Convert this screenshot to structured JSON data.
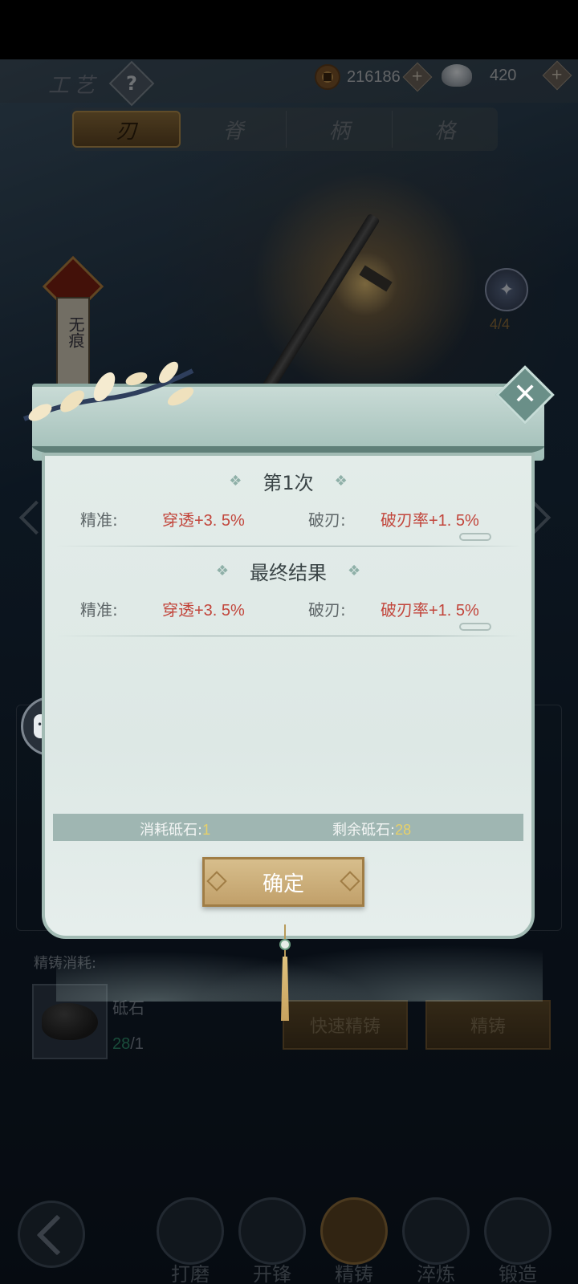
{
  "header": {
    "title": "工艺",
    "help_icon": "?",
    "coins": "216186",
    "silver": "420",
    "plus": "+"
  },
  "tabs": [
    {
      "label": "刃",
      "active": true
    },
    {
      "label": "脊",
      "active": false
    },
    {
      "label": "柄",
      "active": false
    },
    {
      "label": "格",
      "active": false
    }
  ],
  "weapon": {
    "name_vertical": "无痕",
    "skill_count": "4/4"
  },
  "modal": {
    "close_symbol": "✕",
    "round_title": "第1次",
    "final_title": "最终结果",
    "rows": [
      {
        "label1": "精准:",
        "value1": "穿透+3. 5%",
        "label2": "破刃:",
        "value2": "破刃率+1. 5%"
      },
      {
        "label1": "精准:",
        "value1": "穿透+3. 5%",
        "label2": "破刃:",
        "value2": "破刃率+1. 5%"
      }
    ],
    "consumed_label": "消耗砥石:",
    "consumed_value": "1",
    "remaining_label": "剩余砥石:",
    "remaining_value": "28",
    "confirm_label": "确定"
  },
  "refine": {
    "cost_label": "精铸消耗:",
    "stone_name": "砥石",
    "stone_have": "28",
    "stone_need": "/1",
    "quick_button": "快速精铸",
    "refine_button": "精铸"
  },
  "bottom_nav": [
    {
      "label": "打磨",
      "active": false
    },
    {
      "label": "开锋",
      "active": false
    },
    {
      "label": "精铸",
      "active": true
    },
    {
      "label": "淬炼",
      "active": false
    },
    {
      "label": "锻造",
      "active": false
    }
  ],
  "colors": {
    "stat_value": "#c2453b",
    "stone_number": "#e6d06a",
    "confirm_gold": "#c1a06a",
    "modal_teal": "#9fbdb6"
  }
}
